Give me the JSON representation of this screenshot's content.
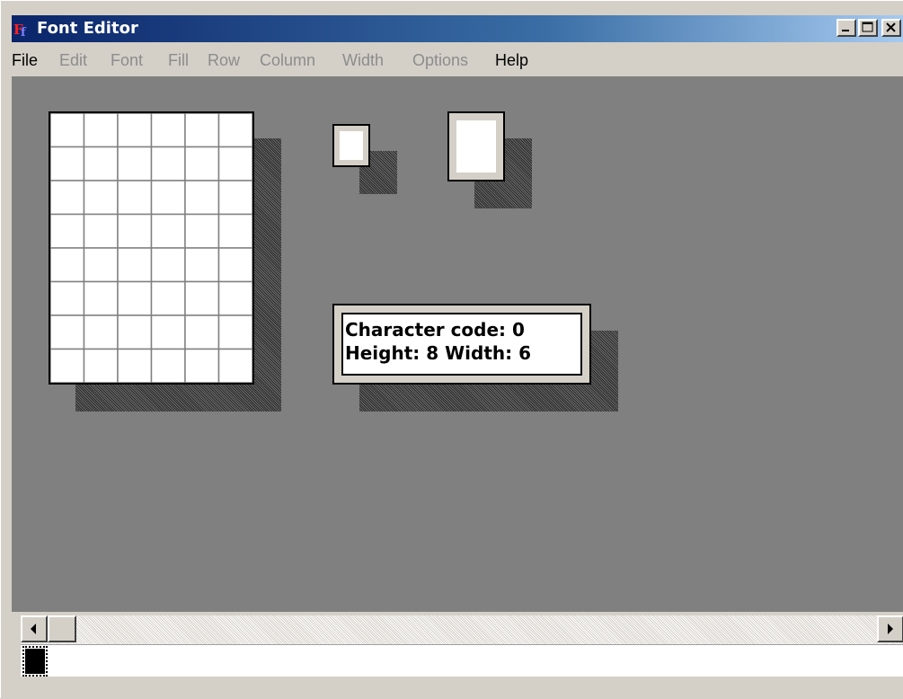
{
  "window": {
    "title": "Font Editor",
    "icon": "font-editor-app-icon"
  },
  "titlebar_buttons": [
    "minimize-icon",
    "maximize-icon",
    "close-icon"
  ],
  "menu": {
    "items": [
      {
        "label": "File",
        "enabled": true
      },
      {
        "label": "Edit",
        "enabled": false
      },
      {
        "label": "Font",
        "enabled": false
      },
      {
        "label": "Fill",
        "enabled": false
      },
      {
        "label": "Row",
        "enabled": false
      },
      {
        "label": "Column",
        "enabled": false
      },
      {
        "label": "Width",
        "enabled": false
      },
      {
        "label": "Options",
        "enabled": false
      },
      {
        "label": "Help",
        "enabled": true
      }
    ]
  },
  "editor": {
    "rows": 8,
    "columns": 6
  },
  "info": {
    "line1": "Character code: 0",
    "line2": "Height: 8 Width: 6"
  },
  "scrollbar": {
    "left_icon": "arrow-left-icon",
    "right_icon": "arrow-right-icon"
  },
  "colors": {
    "title_start": "#0a246a",
    "title_end": "#a6caf0",
    "workspace": "#808080",
    "face": "#d4d0c8"
  }
}
